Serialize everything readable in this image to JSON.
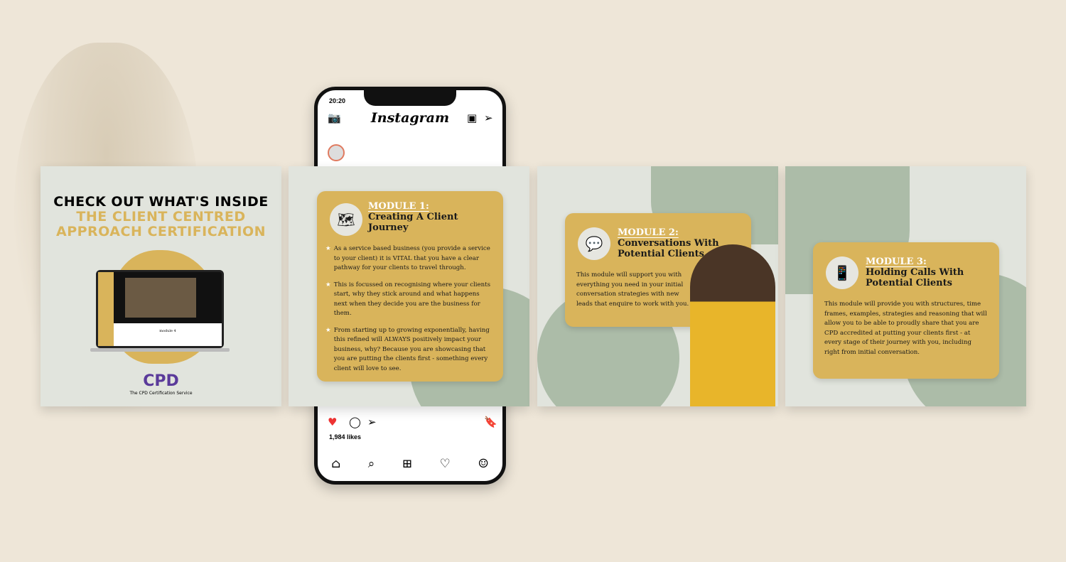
{
  "phone": {
    "time": "20:20",
    "app_title": "Instagram",
    "likes": "1,984 likes"
  },
  "intro": {
    "line1": "CHECK OUT WHAT'S INSIDE",
    "line2": "THE CLIENT CENTRED",
    "line3": "APPROACH CERTIFICATION",
    "screen_label": "module 4",
    "logo": "CPD",
    "logo_sub": "The CPD Certification Service"
  },
  "modules": [
    {
      "label": "MODULE 1:",
      "title": "Creating A Client Journey",
      "bullets": [
        "As a service based business (you provide a service to your client) it is VITAL that you have a clear pathway for your clients to travel through.",
        "This is focussed on recognising where your clients start, why they stick around and what happens next when they decide you are the business for them.",
        "From starting up to growing exponentially, having this refined will ALWAYS positively impact your business, why? Because you are showcasing that you are putting the clients first - something every client will love to see."
      ]
    },
    {
      "label": "MODULE 2:",
      "title": "Conversations With Potential Clients",
      "body": "This module will support you with everything you need in your initial conversation strategies with new leads that enquire to work with you."
    },
    {
      "label": "MODULE 3:",
      "title": "Holding Calls With Potential Clients",
      "body": "This module will provide you with structures, time frames, examples, strategies and reasoning that will allow you to be able to proudly share that you are CPD accredited at putting your clients first - at every stage of their journey with you, including right from initial conversation."
    }
  ],
  "colors": {
    "gold": "#d9b45b",
    "sage": "#9fb29b",
    "bg": "#eee6d8"
  }
}
